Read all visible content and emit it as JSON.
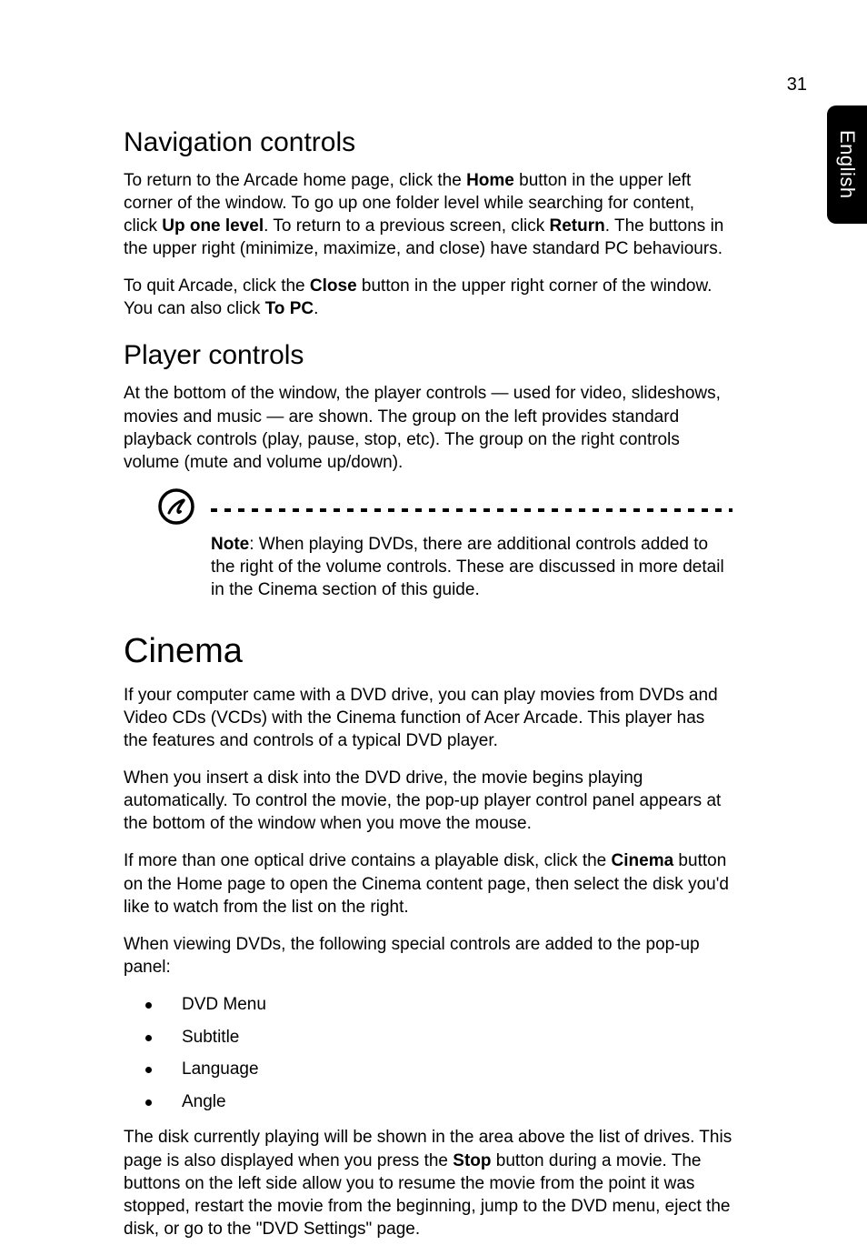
{
  "page_number": "31",
  "side_tab": "English",
  "sections": {
    "nav": {
      "heading": "Navigation controls",
      "p1_a": "To return to the Arcade home page, click the ",
      "p1_b1": "Home",
      "p1_c": " button in the upper left corner of the window. To go up one folder level while searching for content, click ",
      "p1_b2": "Up one level",
      "p1_d": ". To return to a previous screen, click ",
      "p1_b3": "Return",
      "p1_e": ". The buttons in the upper right (minimize, maximize, and close) have standard PC behaviours.",
      "p2_a": "To quit Arcade, click the ",
      "p2_b1": "Close",
      "p2_c": " button in the upper right corner of the window. You can also click ",
      "p2_b2": "To PC",
      "p2_d": "."
    },
    "player": {
      "heading": "Player controls",
      "p1": "At the bottom of the window, the player controls — used for video, slideshows, movies and music — are shown. The group on the left provides standard playback controls (play, pause, stop, etc). The group on the right controls volume (mute and volume up/down).",
      "note_label": "Note",
      "note_body": ": When playing DVDs, there are additional controls added to the right of the volume controls. These are discussed in more detail in the Cinema section of this guide."
    },
    "cinema": {
      "heading": "Cinema",
      "p1": "If your computer came with a DVD drive, you can play movies from DVDs and Video CDs (VCDs) with the Cinema function of Acer Arcade. This player has the features and controls of a typical DVD player.",
      "p2": "When you insert a disk into the DVD drive, the movie begins playing automatically. To control the movie, the pop-up player control panel appears at the bottom of the window when you move the mouse.",
      "p3_a": "If more than one optical drive contains a playable disk, click the ",
      "p3_b1": "Cinema",
      "p3_c": " button on the Home page to open the Cinema content page, then select the disk you'd like to watch from the list on the right.",
      "p4": "When viewing DVDs, the following special controls are added to the pop-up panel:",
      "bullets": [
        "DVD Menu",
        "Subtitle",
        "Language",
        "Angle"
      ],
      "p5_a": "The disk currently playing will be shown in the area above the list of drives. This page is also displayed when you press the ",
      "p5_b1": "Stop",
      "p5_c": " button during a movie. The buttons on the left side allow you to resume the movie from the point it was stopped, restart the movie from the beginning, jump to the DVD menu, eject the disk, or go to the \"DVD Settings\" page."
    }
  }
}
